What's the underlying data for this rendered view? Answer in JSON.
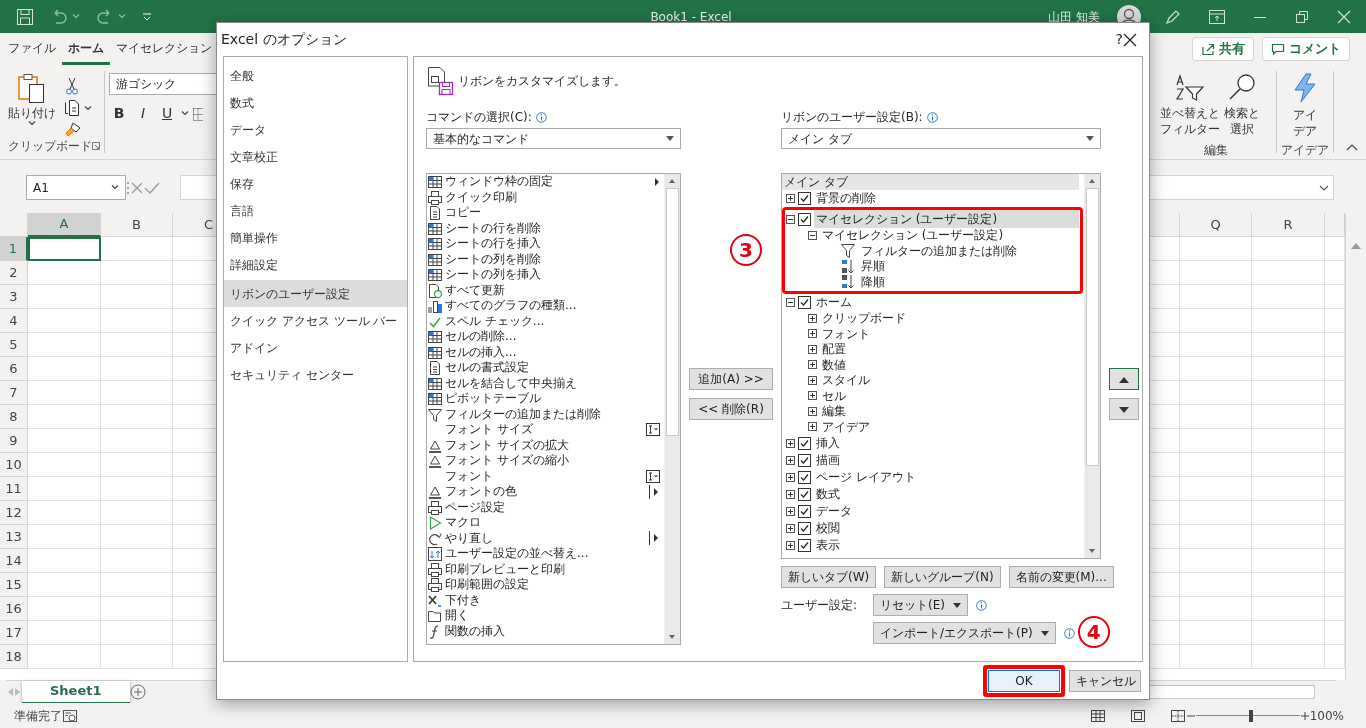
{
  "window": {
    "title": "Book1  -  Excel",
    "user": "山田 知美"
  },
  "ribbon_tabs": [
    {
      "label": "ファイル",
      "selected": false
    },
    {
      "label": "ホーム",
      "selected": true
    },
    {
      "label": "マイセレクション",
      "selected": false
    }
  ],
  "share_button": "共有",
  "comment_button": "コメント",
  "clipboard_group": {
    "paste": "貼り付け",
    "label": "クリップボード"
  },
  "font_group": {
    "font_name": "游ゴシック",
    "styles": [
      "B",
      "I",
      "U"
    ]
  },
  "edit_group": {
    "label": "編集",
    "buttons": [
      {
        "lines": [
          "並べ替えと",
          "フィルター"
        ]
      },
      {
        "lines": [
          "検索と",
          "選択"
        ]
      }
    ]
  },
  "idea_group": {
    "button": "アイデア",
    "label": "アイデア"
  },
  "name_box": "A1",
  "columns": [
    {
      "label": "A",
      "selected": true
    },
    {
      "label": "B",
      "selected": false
    },
    {
      "label": "C",
      "selected": false
    },
    {
      "label": "Q",
      "selected": false
    },
    {
      "label": "R",
      "selected": false
    }
  ],
  "rows": [
    {
      "label": "1",
      "selected": true
    },
    {
      "label": "2",
      "selected": false
    },
    {
      "label": "3",
      "selected": false
    },
    {
      "label": "4",
      "selected": false
    },
    {
      "label": "5",
      "selected": false
    },
    {
      "label": "6",
      "selected": false
    },
    {
      "label": "7",
      "selected": false
    },
    {
      "label": "8",
      "selected": false
    },
    {
      "label": "9",
      "selected": false
    },
    {
      "label": "10",
      "selected": false
    },
    {
      "label": "11",
      "selected": false
    },
    {
      "label": "12",
      "selected": false
    },
    {
      "label": "13",
      "selected": false
    },
    {
      "label": "14",
      "selected": false
    },
    {
      "label": "15",
      "selected": false
    },
    {
      "label": "16",
      "selected": false
    },
    {
      "label": "17",
      "selected": false
    },
    {
      "label": "18",
      "selected": false
    }
  ],
  "sheet_tabs": [
    {
      "label": "Sheet1",
      "selected": true
    }
  ],
  "status_bar": {
    "text": "準備完了",
    "zoom": {
      "level": 0.53,
      "reading": "100%"
    }
  },
  "dialog": {
    "title": "Excel のオプション",
    "help": "?",
    "nav": [
      {
        "label": "全般",
        "selected": false
      },
      {
        "label": "数式",
        "selected": false
      },
      {
        "label": "データ",
        "selected": false
      },
      {
        "label": "文章校正",
        "selected": false
      },
      {
        "label": "保存",
        "selected": false
      },
      {
        "label": "言語",
        "selected": false
      },
      {
        "label": "簡単操作",
        "selected": false
      },
      {
        "label": "詳細設定",
        "selected": false
      },
      {
        "label": "リボンのユーザー設定",
        "selected": true
      },
      {
        "label": "クイック アクセス ツール バー",
        "selected": false
      },
      {
        "label": "アドイン",
        "selected": false
      },
      {
        "label": "セキュリティ センター",
        "selected": false
      }
    ],
    "heading": "リボンをカスタマイズします。",
    "commands_label": "コマンドの選択(C):",
    "commands_dropdown": "基本的なコマンド",
    "ribbon_label": "リボンのユーザー設定(B):",
    "ribbon_dropdown": "メイン タブ",
    "commands": [
      {
        "label": "ウィンドウ枠の固定",
        "kind": "submenu"
      },
      {
        "label": "クイック印刷",
        "kind": "plain"
      },
      {
        "label": "コピー",
        "kind": "plain"
      },
      {
        "label": "シートの行を削除",
        "kind": "plain"
      },
      {
        "label": "シートの行を挿入",
        "kind": "plain"
      },
      {
        "label": "シートの列を削除",
        "kind": "plain"
      },
      {
        "label": "シートの列を挿入",
        "kind": "plain"
      },
      {
        "label": "すべて更新",
        "kind": "plain"
      },
      {
        "label": "すべてのグラフの種類...",
        "kind": "plain"
      },
      {
        "label": "スペル チェック...",
        "kind": "plain"
      },
      {
        "label": "セルの削除...",
        "kind": "plain"
      },
      {
        "label": "セルの挿入...",
        "kind": "plain"
      },
      {
        "label": "セルの書式設定",
        "kind": "plain"
      },
      {
        "label": "セルを結合して中央揃え",
        "kind": "plain"
      },
      {
        "label": "ピボットテーブル",
        "kind": "plain"
      },
      {
        "label": "フィルターの追加または削除",
        "kind": "plain"
      },
      {
        "label": "フォント サイズ",
        "kind": "combo"
      },
      {
        "label": "フォント サイズの拡大",
        "kind": "plain"
      },
      {
        "label": "フォント サイズの縮小",
        "kind": "plain"
      },
      {
        "label": "フォント",
        "kind": "combo"
      },
      {
        "label": "フォントの色",
        "kind": "split"
      },
      {
        "label": "ページ設定",
        "kind": "plain"
      },
      {
        "label": "マクロ",
        "kind": "plain"
      },
      {
        "label": "やり直し",
        "kind": "split"
      },
      {
        "label": "ユーザー設定の並べ替え...",
        "kind": "plain"
      },
      {
        "label": "印刷プレビューと印刷",
        "kind": "plain"
      },
      {
        "label": "印刷範囲の設定",
        "kind": "plain"
      },
      {
        "label": "下付き",
        "kind": "plain"
      },
      {
        "label": "開く",
        "kind": "plain"
      },
      {
        "label": "関数の挿入",
        "kind": "plain"
      }
    ],
    "add_button": "追加(A) >>",
    "remove_button": "<< 削除(R)",
    "tree_header": "メイン タブ",
    "tree": [
      {
        "label": "背景の削除",
        "kind": "tab",
        "checked": true,
        "expanded": false,
        "selected": false
      },
      {
        "label": "マイセレクション (ユーザー設定)",
        "kind": "tab",
        "checked": true,
        "expanded": true,
        "selected": true,
        "children": [
          {
            "label": "マイセレクション (ユーザー設定)",
            "kind": "group",
            "expanded": true,
            "selected": false,
            "children": [
              {
                "label": "フィルターの追加または削除",
                "kind": "command",
                "selected": false
              },
              {
                "label": "昇順",
                "kind": "command",
                "selected": false
              },
              {
                "label": "降順",
                "kind": "command",
                "selected": false
              }
            ]
          }
        ]
      },
      {
        "label": "ホーム",
        "kind": "tab",
        "checked": true,
        "expanded": true,
        "selected": false,
        "children": [
          {
            "label": "クリップボード",
            "kind": "group",
            "expanded": false,
            "selected": false
          },
          {
            "label": "フォント",
            "kind": "group",
            "expanded": false,
            "selected": false
          },
          {
            "label": "配置",
            "kind": "group",
            "expanded": false,
            "selected": false
          },
          {
            "label": "数値",
            "kind": "group",
            "expanded": false,
            "selected": false
          },
          {
            "label": "スタイル",
            "kind": "group",
            "expanded": false,
            "selected": false
          },
          {
            "label": "セル",
            "kind": "group",
            "expanded": false,
            "selected": false
          },
          {
            "label": "編集",
            "kind": "group",
            "expanded": false,
            "selected": false
          },
          {
            "label": "アイデア",
            "kind": "group",
            "expanded": false,
            "selected": false
          }
        ]
      },
      {
        "label": "挿入",
        "kind": "tab",
        "checked": true,
        "expanded": false,
        "selected": false
      },
      {
        "label": "描画",
        "kind": "tab",
        "checked": true,
        "expanded": false,
        "selected": false
      },
      {
        "label": "ページ レイアウト",
        "kind": "tab",
        "checked": true,
        "expanded": false,
        "selected": false
      },
      {
        "label": "数式",
        "kind": "tab",
        "checked": true,
        "expanded": false,
        "selected": false
      },
      {
        "label": "データ",
        "kind": "tab",
        "checked": true,
        "expanded": false,
        "selected": false
      },
      {
        "label": "校閲",
        "kind": "tab",
        "checked": true,
        "expanded": false,
        "selected": false
      },
      {
        "label": "表示",
        "kind": "tab",
        "checked": true,
        "expanded": false,
        "selected": false
      }
    ],
    "tree_buttons": [
      "新しいタブ(W)",
      "新しいグループ(N)",
      "名前の変更(M)..."
    ],
    "customize_label": "ユーザー設定:",
    "reset_button": "リセット(E)",
    "import_export_button": "インポート/エクスポート(P)",
    "ok_button": {
      "label": "OK",
      "highlighted": true
    },
    "cancel_button": "キャンセル"
  },
  "annotations": [
    {
      "number": "3"
    },
    {
      "number": "4"
    }
  ]
}
